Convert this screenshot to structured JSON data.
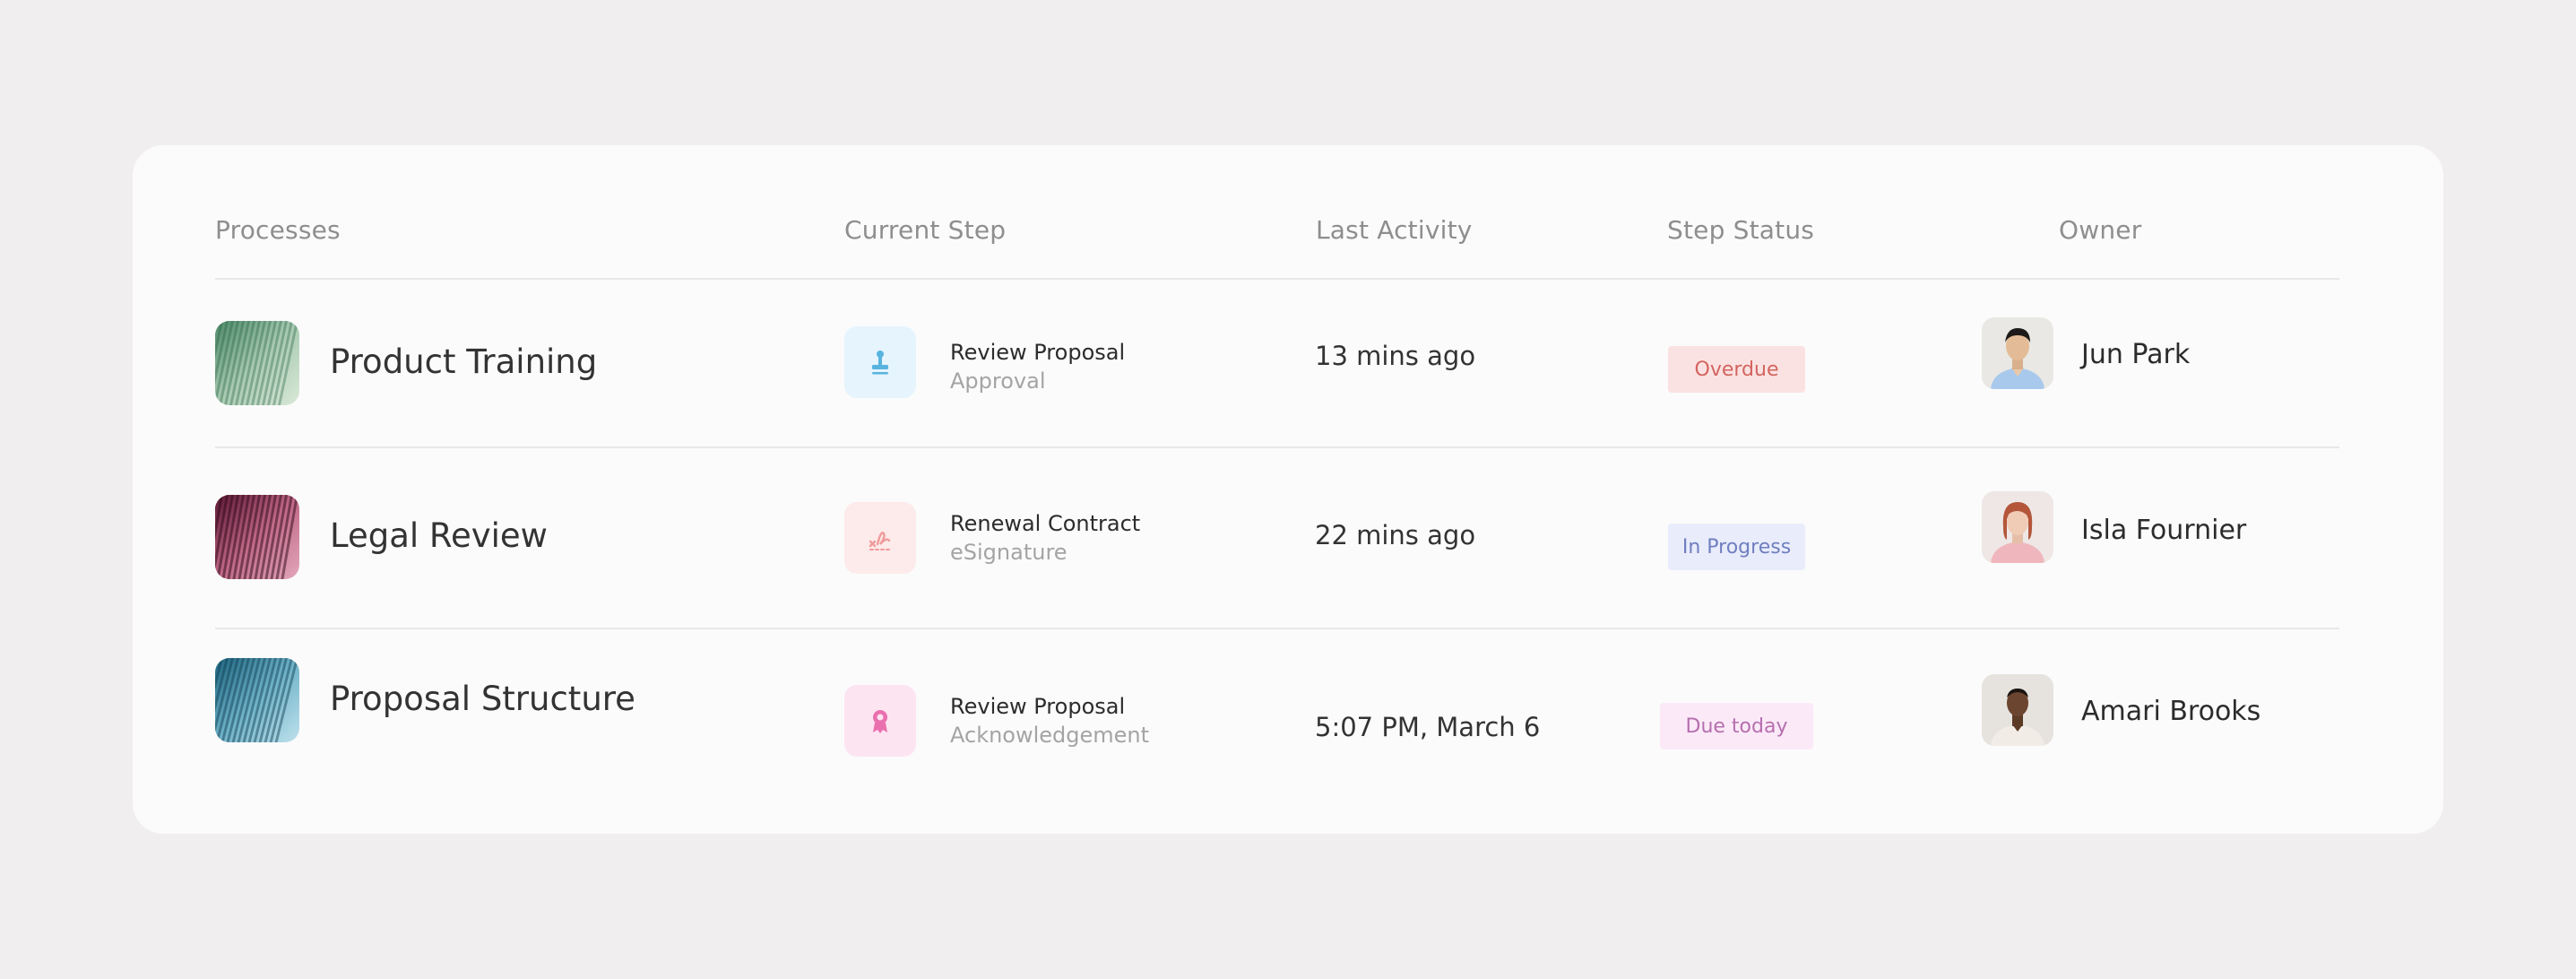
{
  "table": {
    "headers": {
      "processes": "Processes",
      "current_step": "Current Step",
      "last_activity": "Last Activity",
      "step_status": "Step Status",
      "owner": "Owner"
    },
    "rows": [
      {
        "process": "Product Training",
        "thumb_colors": [
          "#5f9a78",
          "#cfe0cf"
        ],
        "step_title": "Review Proposal",
        "step_type": "Approval",
        "step_icon": "stamp-icon",
        "step_icon_bg": "#e5f4fd",
        "step_icon_color": "#58b3df",
        "last_activity": "13 mins ago",
        "status": "Overdue",
        "status_bg": "#fbe2e2",
        "status_color": "#d3645f",
        "owner": "Jun Park"
      },
      {
        "process": "Legal Review",
        "thumb_colors": [
          "#6b1e3e",
          "#d27e98"
        ],
        "step_title": "Renewal Contract",
        "step_type": "eSignature",
        "step_icon": "signature-icon",
        "step_icon_bg": "#fdeaea",
        "step_icon_color": "#ef9a9a",
        "last_activity": "22 mins ago",
        "status": "In Progress",
        "status_bg": "#e9ecfb",
        "status_color": "#6f7fc0",
        "owner": "Isla Fournier"
      },
      {
        "process": "Proposal Structure",
        "thumb_colors": [
          "#2e7590",
          "#9ed1e0"
        ],
        "step_title": "Review Proposal",
        "step_type": "Acknowledgement",
        "step_icon": "award-ribbon-icon",
        "step_icon_bg": "#fde4f1",
        "step_icon_color": "#ea6fae",
        "last_activity": "5:07 PM, March 6",
        "status": "Due today",
        "status_bg": "#fbe9f8",
        "status_color": "#b56fae",
        "owner": "Amari Brooks"
      }
    ]
  }
}
